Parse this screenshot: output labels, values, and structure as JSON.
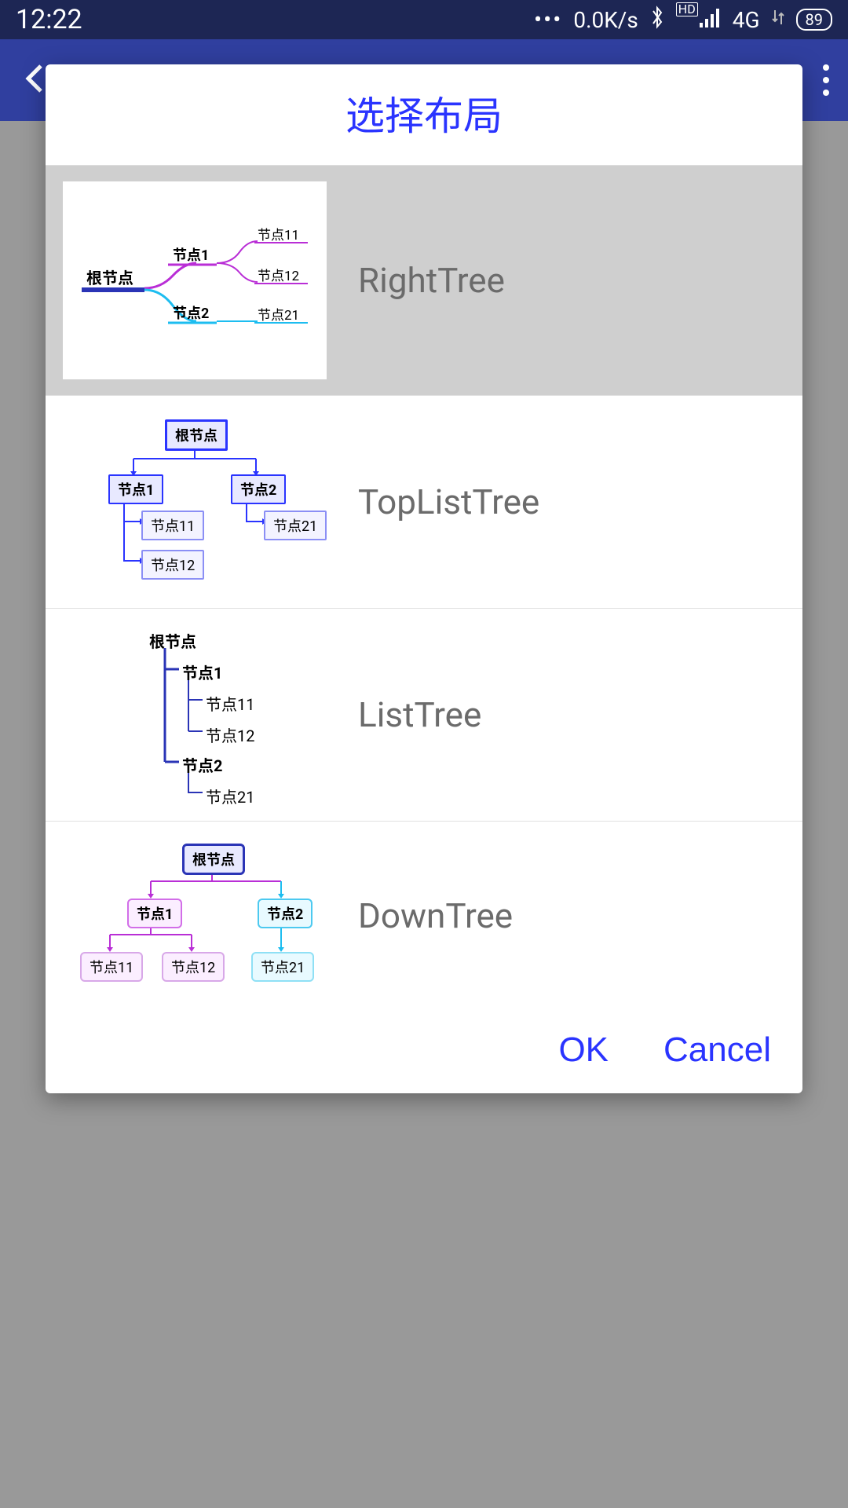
{
  "status": {
    "time": "12:22",
    "speed": "0.0K/s",
    "network": "4G",
    "hd": "HD",
    "battery": "89"
  },
  "dialog": {
    "title": "选择布局",
    "ok": "OK",
    "cancel": "Cancel"
  },
  "options": [
    {
      "label": "RightTree",
      "selected": true
    },
    {
      "label": "TopListTree",
      "selected": false
    },
    {
      "label": "ListTree",
      "selected": false
    },
    {
      "label": "DownTree",
      "selected": false
    }
  ],
  "nodes": {
    "root": "根节点",
    "n1": "节点1",
    "n2": "节点2",
    "n11": "节点11",
    "n12": "节点12",
    "n21": "节点21"
  }
}
